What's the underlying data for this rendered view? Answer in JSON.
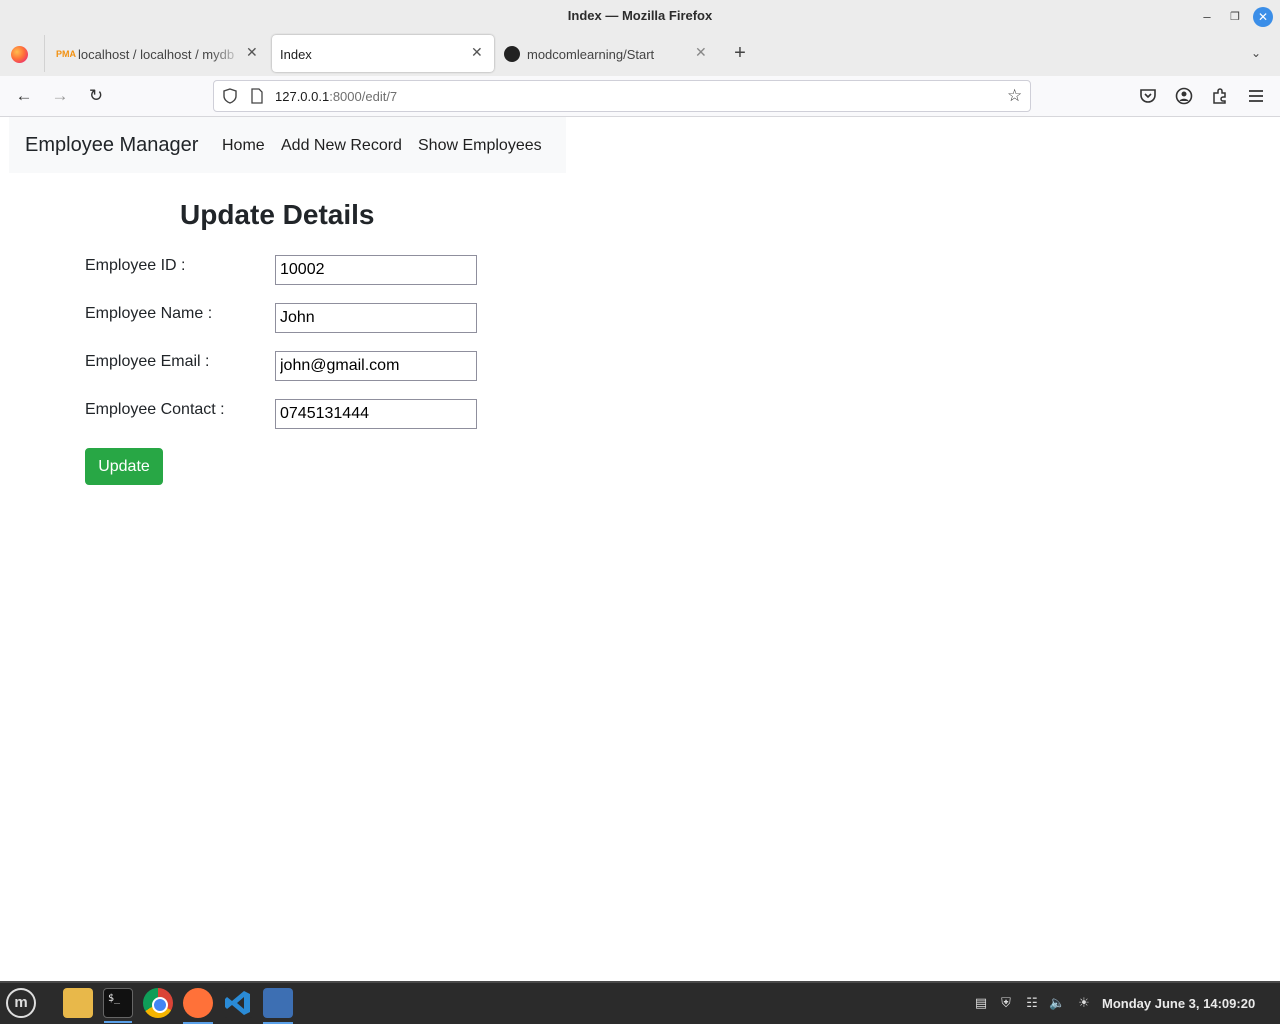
{
  "window": {
    "title": "Index — Mozilla Firefox"
  },
  "tabs": [
    {
      "label": "localhost / localhost / mydb",
      "active": false
    },
    {
      "label": "Index",
      "active": true
    },
    {
      "label": "modcomlearning/Start",
      "active": false
    }
  ],
  "address_bar": {
    "host": "127.0.0.1",
    "path": ":8000/edit/7"
  },
  "app_nav": {
    "brand": "Employee Manager",
    "links": [
      "Home",
      "Add New Record",
      "Show Employees"
    ]
  },
  "form": {
    "title": "Update Details",
    "fields": [
      {
        "label": "Employee ID :",
        "value": "10002"
      },
      {
        "label": "Employee Name :",
        "value": "John"
      },
      {
        "label": "Employee Email :",
        "value": "john@gmail.com"
      },
      {
        "label": "Employee Contact :",
        "value": "0745131444"
      }
    ],
    "submit_label": "Update"
  },
  "taskbar": {
    "clock": "Monday June  3, 14:09:20",
    "terminal_glyph": "$_"
  },
  "colors": {
    "accent_button": "#28a745",
    "navbar_bg": "#f8f9fa"
  },
  "icons": [
    "firefox-icon",
    "phpmyadmin-icon",
    "github-icon",
    "shield-icon",
    "page-icon",
    "star-icon",
    "pocket-icon",
    "account-icon",
    "extensions-icon",
    "hamburger-menu-icon"
  ]
}
